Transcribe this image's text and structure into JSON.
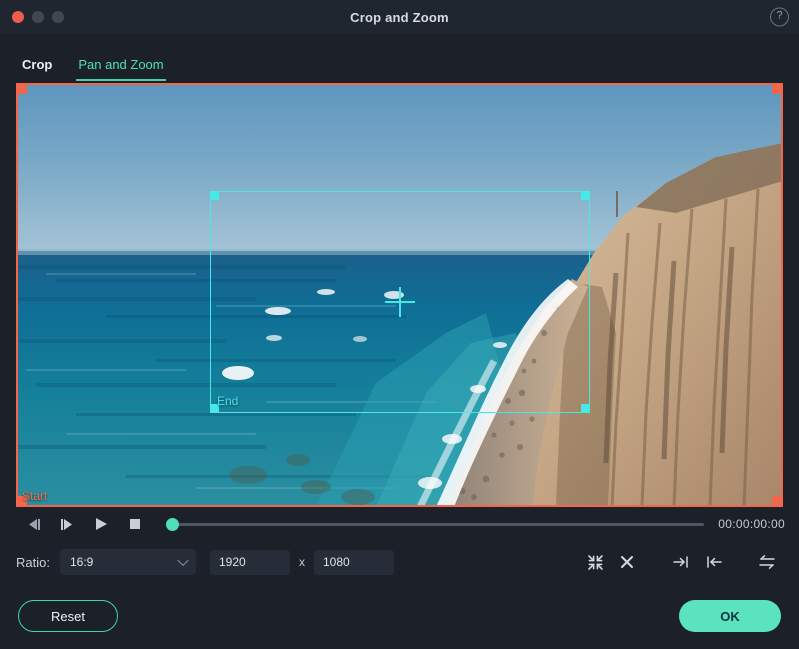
{
  "window": {
    "title": "Crop and Zoom",
    "traffic_lights": [
      "close",
      "minimize",
      "maximize"
    ],
    "help_glyph": "?"
  },
  "tabs": [
    {
      "label": "Crop",
      "active": false
    },
    {
      "label": "Pan and Zoom",
      "active": true
    }
  ],
  "preview": {
    "start_label": "Start",
    "end_label": "End",
    "start_frame_color": "#f2664b",
    "end_frame_color": "#45e9e6",
    "scene": "coastal cliff and sea shoreline"
  },
  "transport": {
    "buttons": [
      {
        "name": "previous-frame",
        "glyph": "prev-frame-icon"
      },
      {
        "name": "next-frame",
        "glyph": "next-frame-icon"
      },
      {
        "name": "play",
        "glyph": "play-icon"
      },
      {
        "name": "stop",
        "glyph": "stop-icon"
      }
    ],
    "progress_percent": 0,
    "timecode": "00:00:00:00"
  },
  "controls": {
    "ratio_label": "Ratio:",
    "ratio_value": "16:9",
    "ratio_options": [
      "16:9"
    ],
    "width": "1920",
    "x_separator": "x",
    "height": "1080",
    "align_buttons": [
      {
        "name": "fit-inward",
        "title": "fit-inward-icon"
      },
      {
        "name": "cross",
        "title": "cross-icon"
      },
      {
        "name": "align-right",
        "title": "align-right-icon"
      },
      {
        "name": "align-left",
        "title": "align-left-icon"
      },
      {
        "name": "swap",
        "title": "swap-icon"
      }
    ]
  },
  "footer": {
    "reset_label": "Reset",
    "ok_label": "OK"
  },
  "colors": {
    "accent": "#5ae3bd",
    "tab_active": "#4fe0b5",
    "start": "#f2664b",
    "end": "#45e9e6",
    "window_bg": "#1b2029",
    "titlebar_bg": "#20262f"
  }
}
